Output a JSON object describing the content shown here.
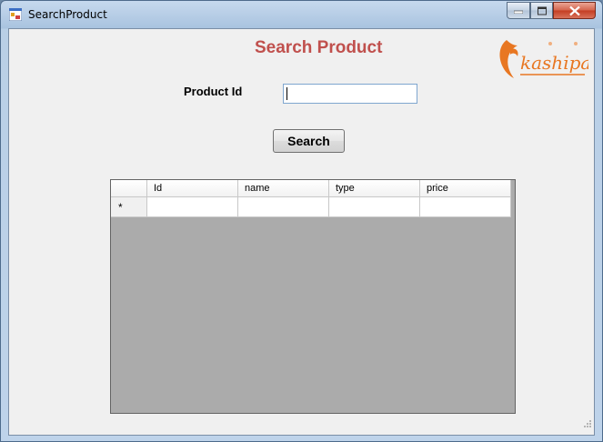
{
  "window": {
    "title": "SearchProduct"
  },
  "heading": "Search Product",
  "form": {
    "product_id_label": "Product Id",
    "product_id_value": "",
    "search_label": "Search"
  },
  "grid": {
    "columns": [
      "Id",
      "name",
      "type",
      "price"
    ],
    "new_row_marker": "*"
  },
  "logo": {
    "text": "kashipara"
  },
  "colors": {
    "heading": "#c0504d",
    "logo": "#e87722",
    "grid_background": "#ababab"
  },
  "icons": [
    "app-icon",
    "minimize-icon",
    "maximize-icon",
    "close-icon",
    "kashipara-logo",
    "resize-grip-icon"
  ]
}
